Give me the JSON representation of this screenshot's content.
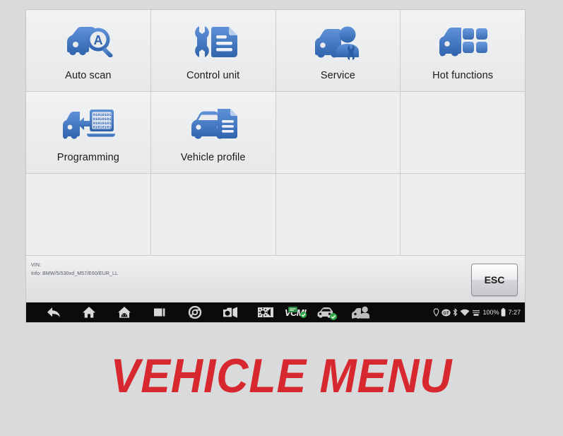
{
  "app": {
    "screen_title": "Vehicle Menu"
  },
  "tiles": [
    {
      "label": "Auto scan",
      "icon": "car-magnifier-a-icon",
      "filled": true
    },
    {
      "label": "Control unit",
      "icon": "wrench-document-icon",
      "filled": true
    },
    {
      "label": "Service",
      "icon": "car-technician-icon",
      "filled": true
    },
    {
      "label": "Hot functions",
      "icon": "car-grid-tiles-icon",
      "filled": true
    },
    {
      "label": "Programming",
      "icon": "car-binary-upload-icon",
      "filled": true
    },
    {
      "label": "Vehicle profile",
      "icon": "car-document-icon",
      "filled": true
    },
    {
      "label": "",
      "icon": "",
      "filled": false
    },
    {
      "label": "",
      "icon": "",
      "filled": false
    },
    {
      "label": "",
      "icon": "",
      "filled": false
    },
    {
      "label": "",
      "icon": "",
      "filled": false
    },
    {
      "label": "",
      "icon": "",
      "filled": false
    },
    {
      "label": "",
      "icon": "",
      "filled": false
    }
  ],
  "infobar": {
    "vin_line": "VIN:",
    "info_line": "Info: BMW/5/530xd_M57/E60/EUR_LL",
    "esc_label": "ESC"
  },
  "navbar": {
    "buttons": [
      {
        "name": "back-icon"
      },
      {
        "name": "home-icon"
      },
      {
        "name": "android-home-icon"
      },
      {
        "name": "recent-apps-icon"
      },
      {
        "name": "chrome-browser-icon"
      },
      {
        "name": "camera-icon"
      },
      {
        "name": "brightness-volume-icon"
      },
      {
        "name": "vcmi-status-icon"
      },
      {
        "name": "vehicle-connection-icon"
      },
      {
        "name": "remote-assistance-icon"
      }
    ],
    "vcmi_label": "VCMI",
    "status_tray": {
      "battery_percent": "100%",
      "clock": "7:27"
    }
  },
  "caption": {
    "text": "VEHICLE MENU",
    "color": "#d6282e"
  },
  "colors": {
    "icon_blue_light": "#5d90d6",
    "icon_blue_dark": "#2e63ae",
    "tile_bg": "#eceef0",
    "page_bg": "#d9dadc",
    "navbar_bg": "#0b0b0b",
    "status_green": "#33a84a"
  }
}
